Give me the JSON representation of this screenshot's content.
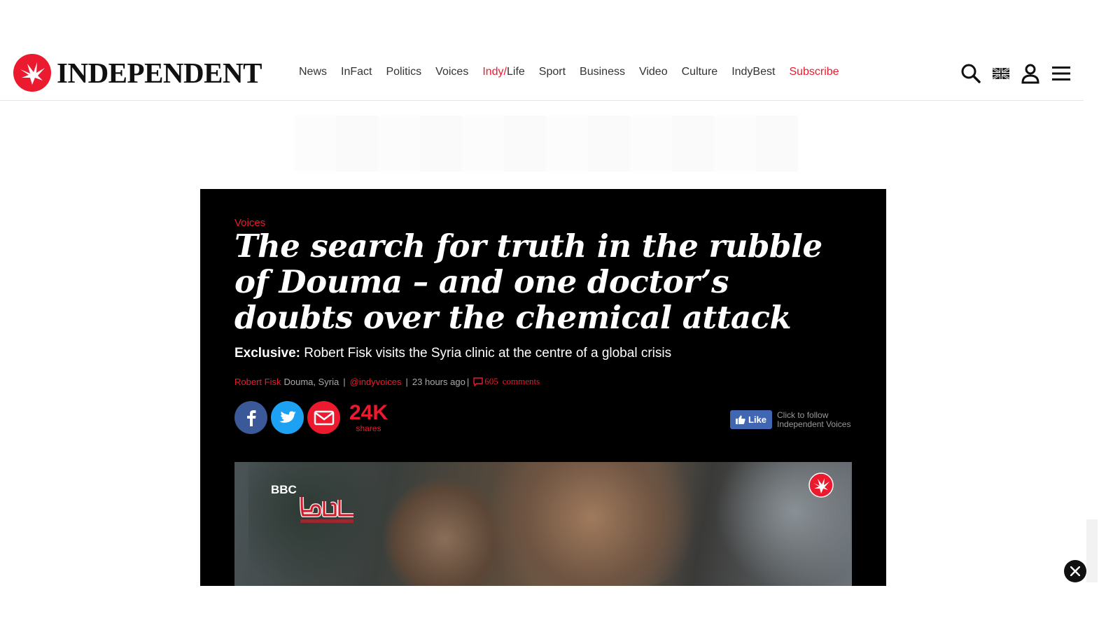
{
  "header": {
    "logo_text": "INDEPENDENT",
    "nav": [
      {
        "label": "News"
      },
      {
        "label": "InFact"
      },
      {
        "label": "Politics"
      },
      {
        "label": "Voices"
      },
      {
        "label_prefix": "Indy/",
        "label_suffix": "Life"
      },
      {
        "label": "Sport"
      },
      {
        "label": "Business"
      },
      {
        "label": "Video"
      },
      {
        "label": "Culture"
      },
      {
        "label": "IndyBest"
      },
      {
        "label": "Subscribe"
      }
    ],
    "icons": [
      "search-icon",
      "uk-flag-icon",
      "account-icon",
      "menu-icon"
    ]
  },
  "article": {
    "section": "Voices",
    "headline": "The search for truth in the rubble of Douma – and one doctor’s doubts over the chemical attack",
    "standfirst_bold": "Exclusive:",
    "standfirst": " Robert Fisk visits the Syria clinic at the centre of a global crisis",
    "byline": {
      "author": "Robert Fisk",
      "location": "Douma, Syria",
      "twitter": "@indyvoices",
      "time": "23 hours ago",
      "comment_count": "605",
      "comment_label": "comments"
    },
    "share": {
      "count": "24K",
      "label": "shares"
    },
    "follow": {
      "like_label": "Like",
      "text_line1": "Click to follow",
      "text_line2": "Independent Voices"
    },
    "video": {
      "channel_tag": "BBC"
    }
  },
  "colors": {
    "brand_red": "#ec1a2e",
    "facebook": "#3b5998",
    "twitter": "#1da1f2",
    "article_bg": "#000000"
  }
}
